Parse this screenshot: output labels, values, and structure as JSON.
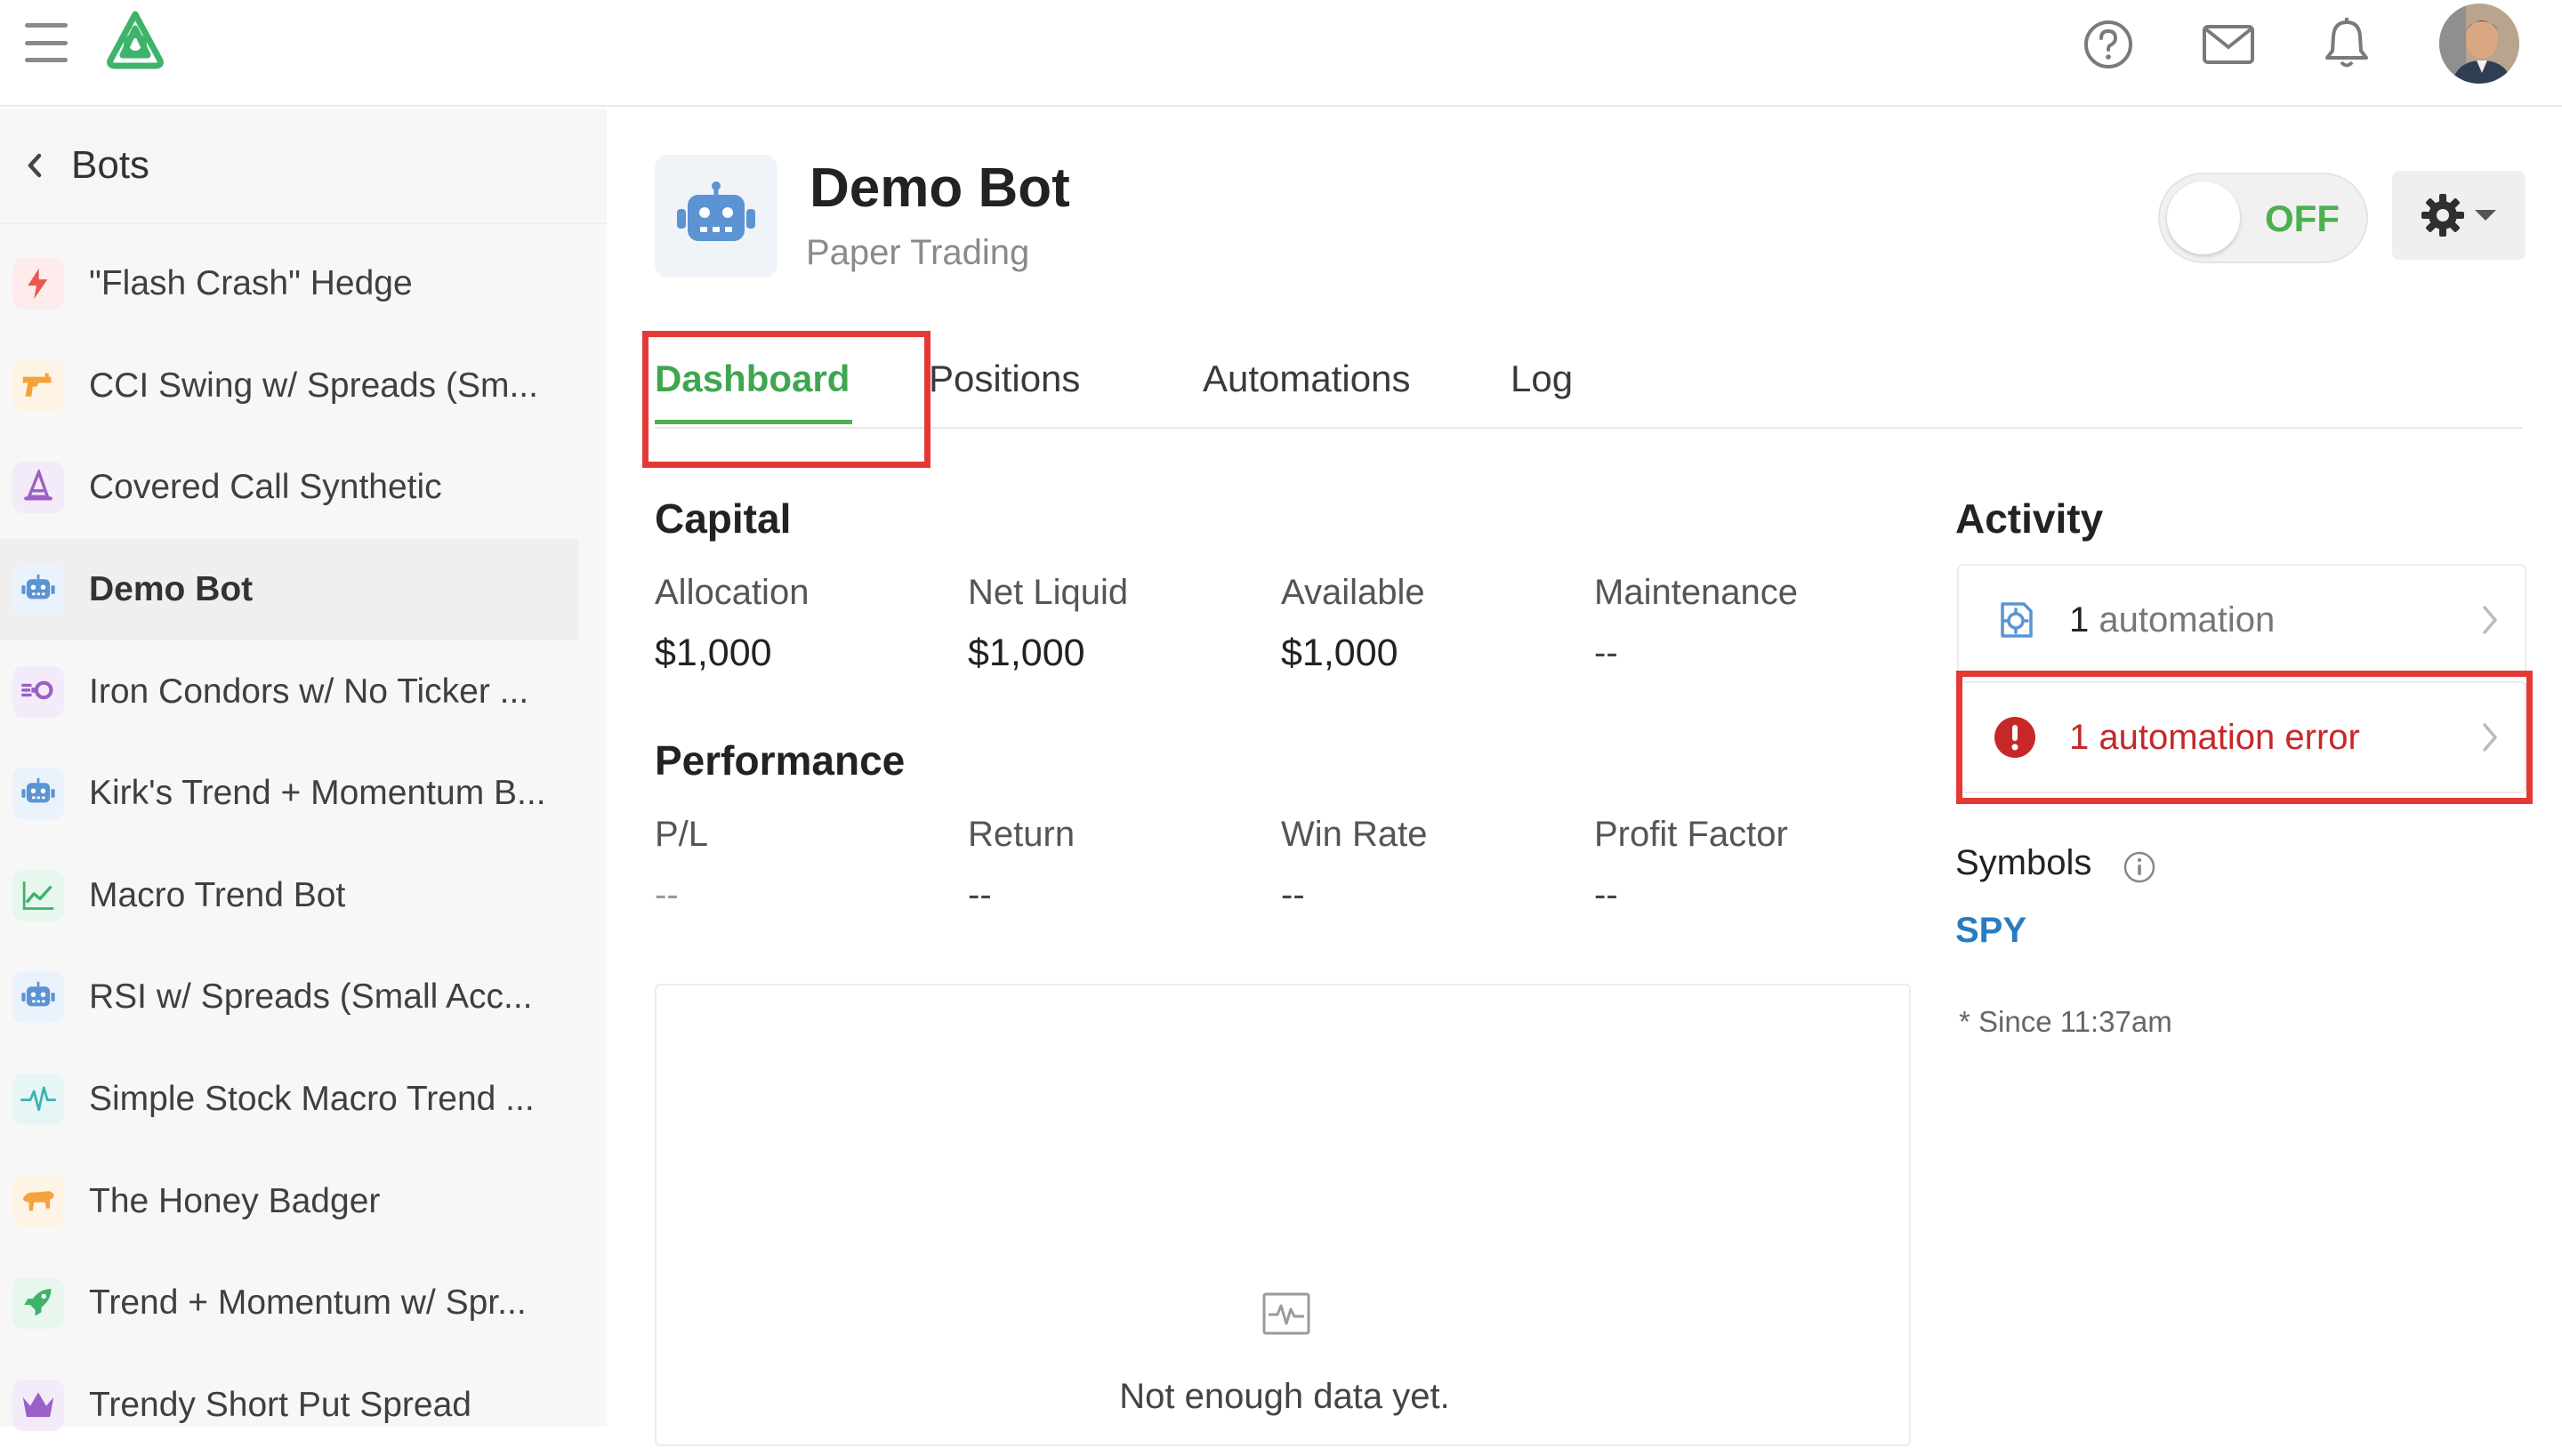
{
  "topbar": {
    "icons": [
      "menu-icon",
      "app-logo",
      "help-icon",
      "mail-icon",
      "bell-icon",
      "user-avatar"
    ]
  },
  "sidebar": {
    "back_label": "Bots",
    "items": [
      {
        "label": "\"Flash Crash\" Hedge",
        "icon": "lightning-icon",
        "color": "#e8584f",
        "bg": "#fdeceb"
      },
      {
        "label": "CCI Swing w/ Spreads (Sm...",
        "icon": "gun-icon",
        "color": "#f5a23c",
        "bg": "#fef4e6"
      },
      {
        "label": "Covered Call Synthetic",
        "icon": "witch-hat-icon",
        "color": "#9b5fc7",
        "bg": "#f3ebf9"
      },
      {
        "label": "Demo Bot",
        "icon": "robot-icon",
        "color": "#5b93d3",
        "bg": "#eaf2fb"
      },
      {
        "label": "Iron Condors w/ No Ticker ...",
        "icon": "binoculars-icon",
        "color": "#9b5fc7",
        "bg": "#f3ebf9"
      },
      {
        "label": "Kirk's Trend + Momentum B...",
        "icon": "robot-icon",
        "color": "#5b93d3",
        "bg": "#eaf2fb"
      },
      {
        "label": "Macro Trend Bot",
        "icon": "chart-line-icon",
        "color": "#3fb36a",
        "bg": "#e8f7ee"
      },
      {
        "label": "RSI w/ Spreads (Small Acc...",
        "icon": "robot-icon",
        "color": "#5b93d3",
        "bg": "#eaf2fb"
      },
      {
        "label": "Simple Stock Macro Trend ...",
        "icon": "pulse-icon",
        "color": "#3bb3b0",
        "bg": "#e6f6f6"
      },
      {
        "label": "The Honey Badger",
        "icon": "badger-icon",
        "color": "#f5a23c",
        "bg": "#fef4e6"
      },
      {
        "label": "Trend + Momentum w/ Spr...",
        "icon": "rocket-icon",
        "color": "#3fb36a",
        "bg": "#e8f7ee"
      },
      {
        "label": "Trendy Short Put Spread",
        "icon": "crown-icon",
        "color": "#9b5fc7",
        "bg": "#f3ebf9"
      }
    ],
    "active_index": 3
  },
  "bot": {
    "name": "Demo Bot",
    "subtitle": "Paper Trading",
    "toggle_label": "OFF"
  },
  "tabs": [
    "Dashboard",
    "Positions",
    "Automations",
    "Log"
  ],
  "capital": {
    "title": "Capital",
    "stats": [
      {
        "label": "Allocation",
        "value": "$1,000"
      },
      {
        "label": "Net Liquid",
        "value": "$1,000"
      },
      {
        "label": "Available",
        "value": "$1,000"
      },
      {
        "label": "Maintenance",
        "value": "--"
      }
    ]
  },
  "performance": {
    "title": "Performance",
    "stats": [
      {
        "label": "P/L",
        "value": "--"
      },
      {
        "label": "Return",
        "value": "--"
      },
      {
        "label": "Win Rate",
        "value": "--"
      },
      {
        "label": "Profit Factor",
        "value": "--"
      }
    ]
  },
  "chart": {
    "empty_message": "Not enough data yet."
  },
  "activity": {
    "title": "Activity",
    "automations": {
      "count": "1",
      "label": "automation"
    },
    "errors": {
      "text": "1 automation error"
    },
    "symbols_label": "Symbols",
    "symbols": [
      "SPY"
    ],
    "since": "* Since 11:37am"
  },
  "colors": {
    "accent_green": "#4caf50",
    "error_red": "#c62828",
    "highlight_red": "#e53935",
    "link_blue": "#2a7bc0"
  }
}
